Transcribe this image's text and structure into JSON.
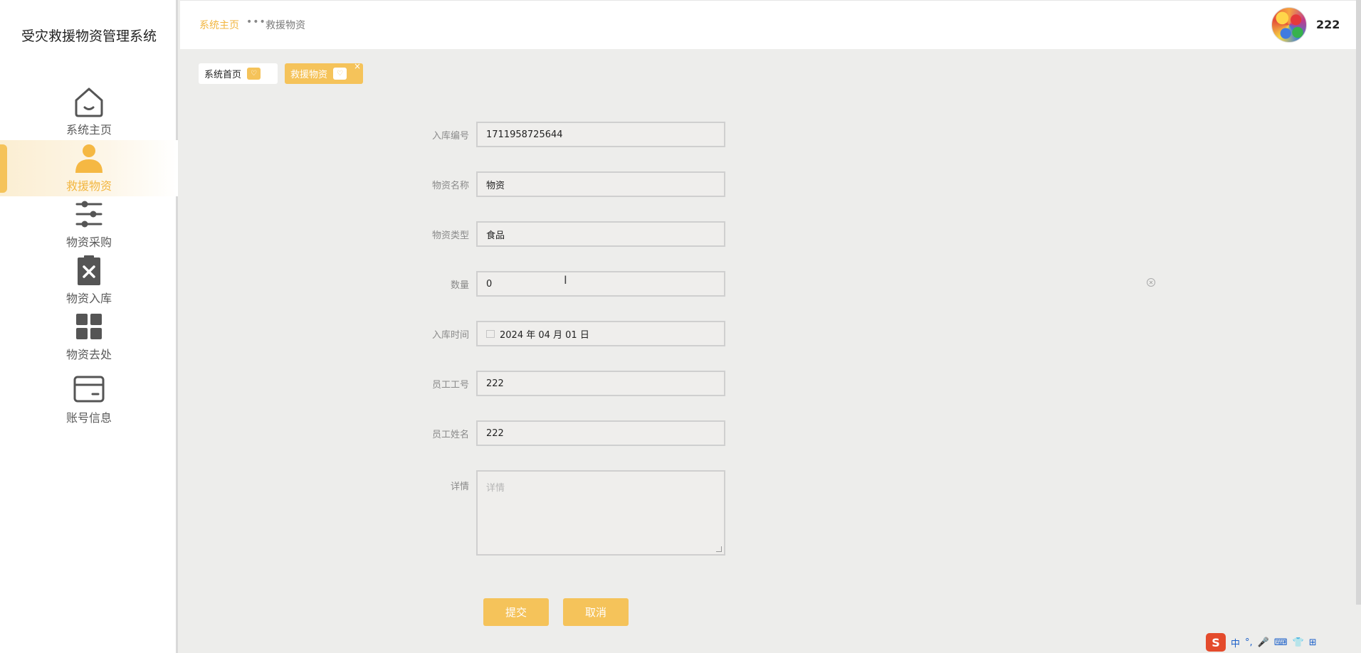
{
  "app": {
    "title": "受灾救援物资管理系统"
  },
  "sidebar": {
    "items": [
      {
        "label": "系统主页",
        "icon": "home-icon"
      },
      {
        "label": "救援物资",
        "icon": "user-icon",
        "active": true
      },
      {
        "label": "物资采购",
        "icon": "sliders-icon"
      },
      {
        "label": "物资入库",
        "icon": "clipboard-x-icon"
      },
      {
        "label": "物资去处",
        "icon": "grid-icon"
      },
      {
        "label": "账号信息",
        "icon": "card-icon"
      }
    ]
  },
  "header": {
    "breadcrumb_home": "系统主页",
    "breadcrumb_sep": "•••",
    "breadcrumb_current": "救援物资",
    "username": "222"
  },
  "tabs": [
    {
      "label": "系统首页"
    },
    {
      "label": "救援物资",
      "close": "×"
    }
  ],
  "form": {
    "fields": [
      {
        "label": "入库编号",
        "value": "1711958725644"
      },
      {
        "label": "物资名称",
        "value": "物资"
      },
      {
        "label": "物资类型",
        "value": "食品"
      },
      {
        "label": "数量",
        "value": "0"
      },
      {
        "label": "入库时间",
        "value": "2024 年 04 月 01 日"
      },
      {
        "label": "员工工号",
        "value": "222"
      },
      {
        "label": "员工姓名",
        "value": "222"
      },
      {
        "label": "详情",
        "placeholder": "详情"
      }
    ],
    "submit_label": "提交",
    "cancel_label": "取消"
  },
  "ime": {
    "logo": "S",
    "mode": "中",
    "punct": "°,"
  },
  "colors": {
    "accent": "#f5c35a",
    "accent_text": "#f2b640",
    "background": "#ededeb"
  }
}
